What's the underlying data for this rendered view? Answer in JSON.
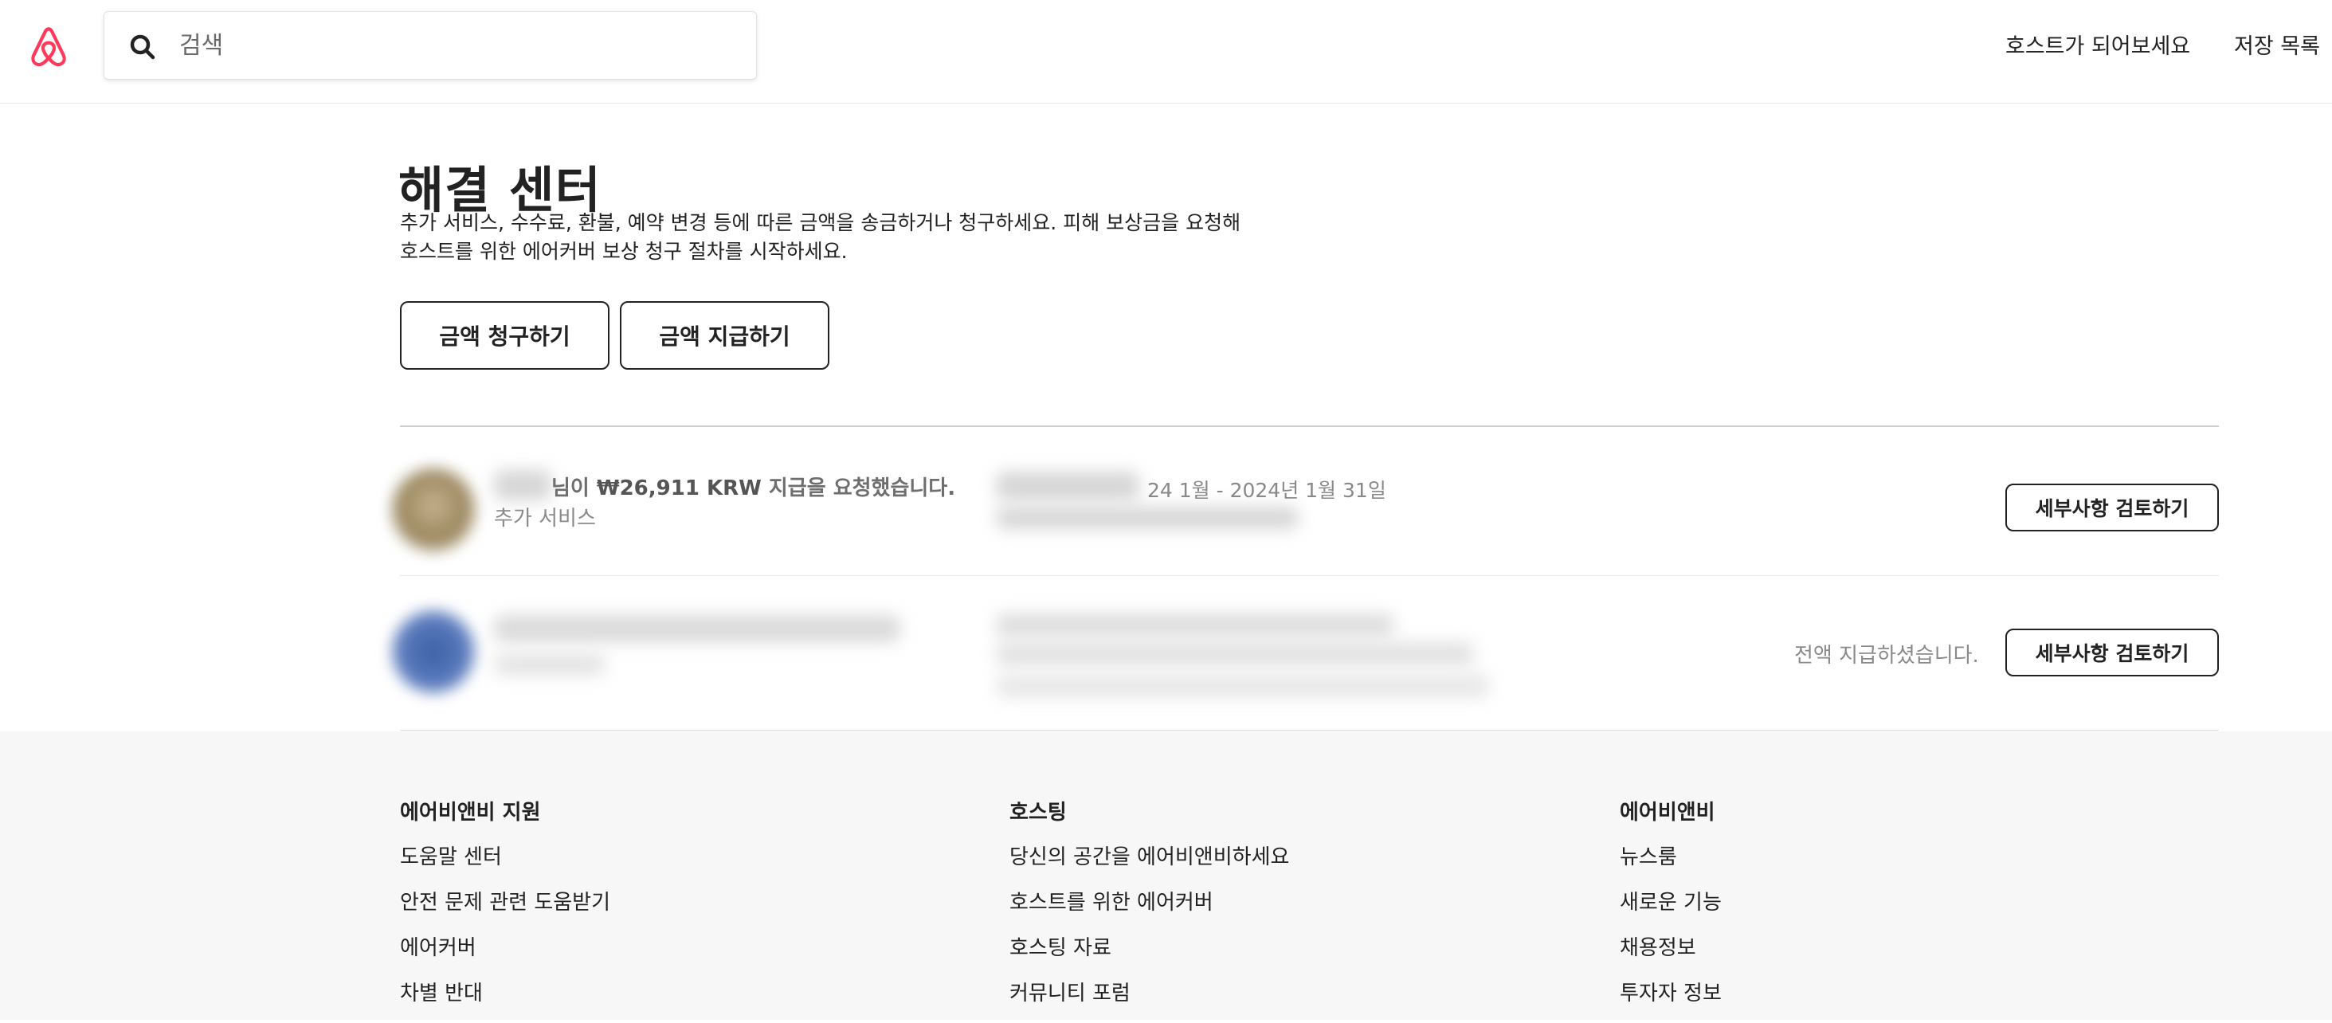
{
  "header": {
    "logo_icon": "airbnb-belo-logo",
    "search": {
      "icon": "search-icon",
      "placeholder": "검색",
      "value": ""
    },
    "nav": {
      "become_host": "호스트가 되어보세요",
      "saved_list": "저장 목록"
    }
  },
  "main": {
    "title": "해결 센터",
    "description_line1": "추가 서비스, 수수료, 환불, 예약 변경 등에 따른 금액을 송금하거나 청구하세요. 피해 보상금을 요청해",
    "description_line2": "호스트를 위한 에어커버 보상 청구 절차를 시작하세요.",
    "buttons": {
      "request_money": "금액 청구하기",
      "send_money": "금액 지급하기"
    },
    "requests": [
      {
        "title_suffix": "님이 ",
        "amount": "₩26,911 KRW",
        "title_end": " 지급을 요청했습니다.",
        "category": "추가 서비스",
        "dates": "24 1월 - 2024년 1월 31일",
        "status": "",
        "review_label": "세부사항 검토하기"
      },
      {
        "status": "전액 지급하셨습니다.",
        "review_label": "세부사항 검토하기"
      }
    ]
  },
  "footer": {
    "columns": [
      {
        "heading": "에어비앤비 지원",
        "links": [
          "도움말 센터",
          "안전 문제 관련 도움받기",
          "에어커버",
          "차별 반대"
        ]
      },
      {
        "heading": "호스팅",
        "links": [
          "당신의 공간을 에어비앤비하세요",
          "호스트를 위한 에어커버",
          "호스팅 자료",
          "커뮤니티 포럼"
        ]
      },
      {
        "heading": "에어비앤비",
        "links": [
          "뉴스룸",
          "새로운 기능",
          "채용정보",
          "투자자 정보"
        ]
      }
    ]
  },
  "colors": {
    "brand": "#FF385C",
    "text": "#222222",
    "muted": "#717171",
    "footer_bg": "#F7F7F7"
  }
}
